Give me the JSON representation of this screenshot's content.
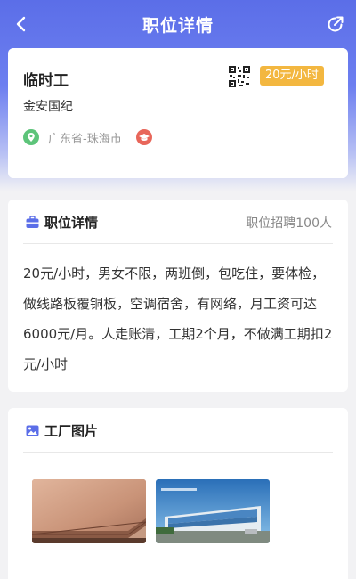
{
  "nav": {
    "title": "职位详情"
  },
  "job": {
    "title": "临时工",
    "company": "金安国纪",
    "salary": "20元/小时",
    "location": "广东省-珠海市"
  },
  "detail": {
    "heading": "职位详情",
    "recruit": "职位招聘100人",
    "description": "20元/小时，男女不限，两班倒，包吃住，要体检，做线路板覆铜板，空调宿舍，有网络，月工资可达6000元/月。人走账清，工期2个月，不做满工期扣2元/小时"
  },
  "photos": {
    "heading": "工厂图片",
    "items": [
      {
        "icon": "copper-clad-board-photo"
      },
      {
        "icon": "factory-building-photo"
      }
    ]
  },
  "colors": {
    "accent": "#5b6ee8",
    "salary_tag": "#f3b740",
    "location_icon": "#5dc47a",
    "education_icon": "#e8665a"
  }
}
